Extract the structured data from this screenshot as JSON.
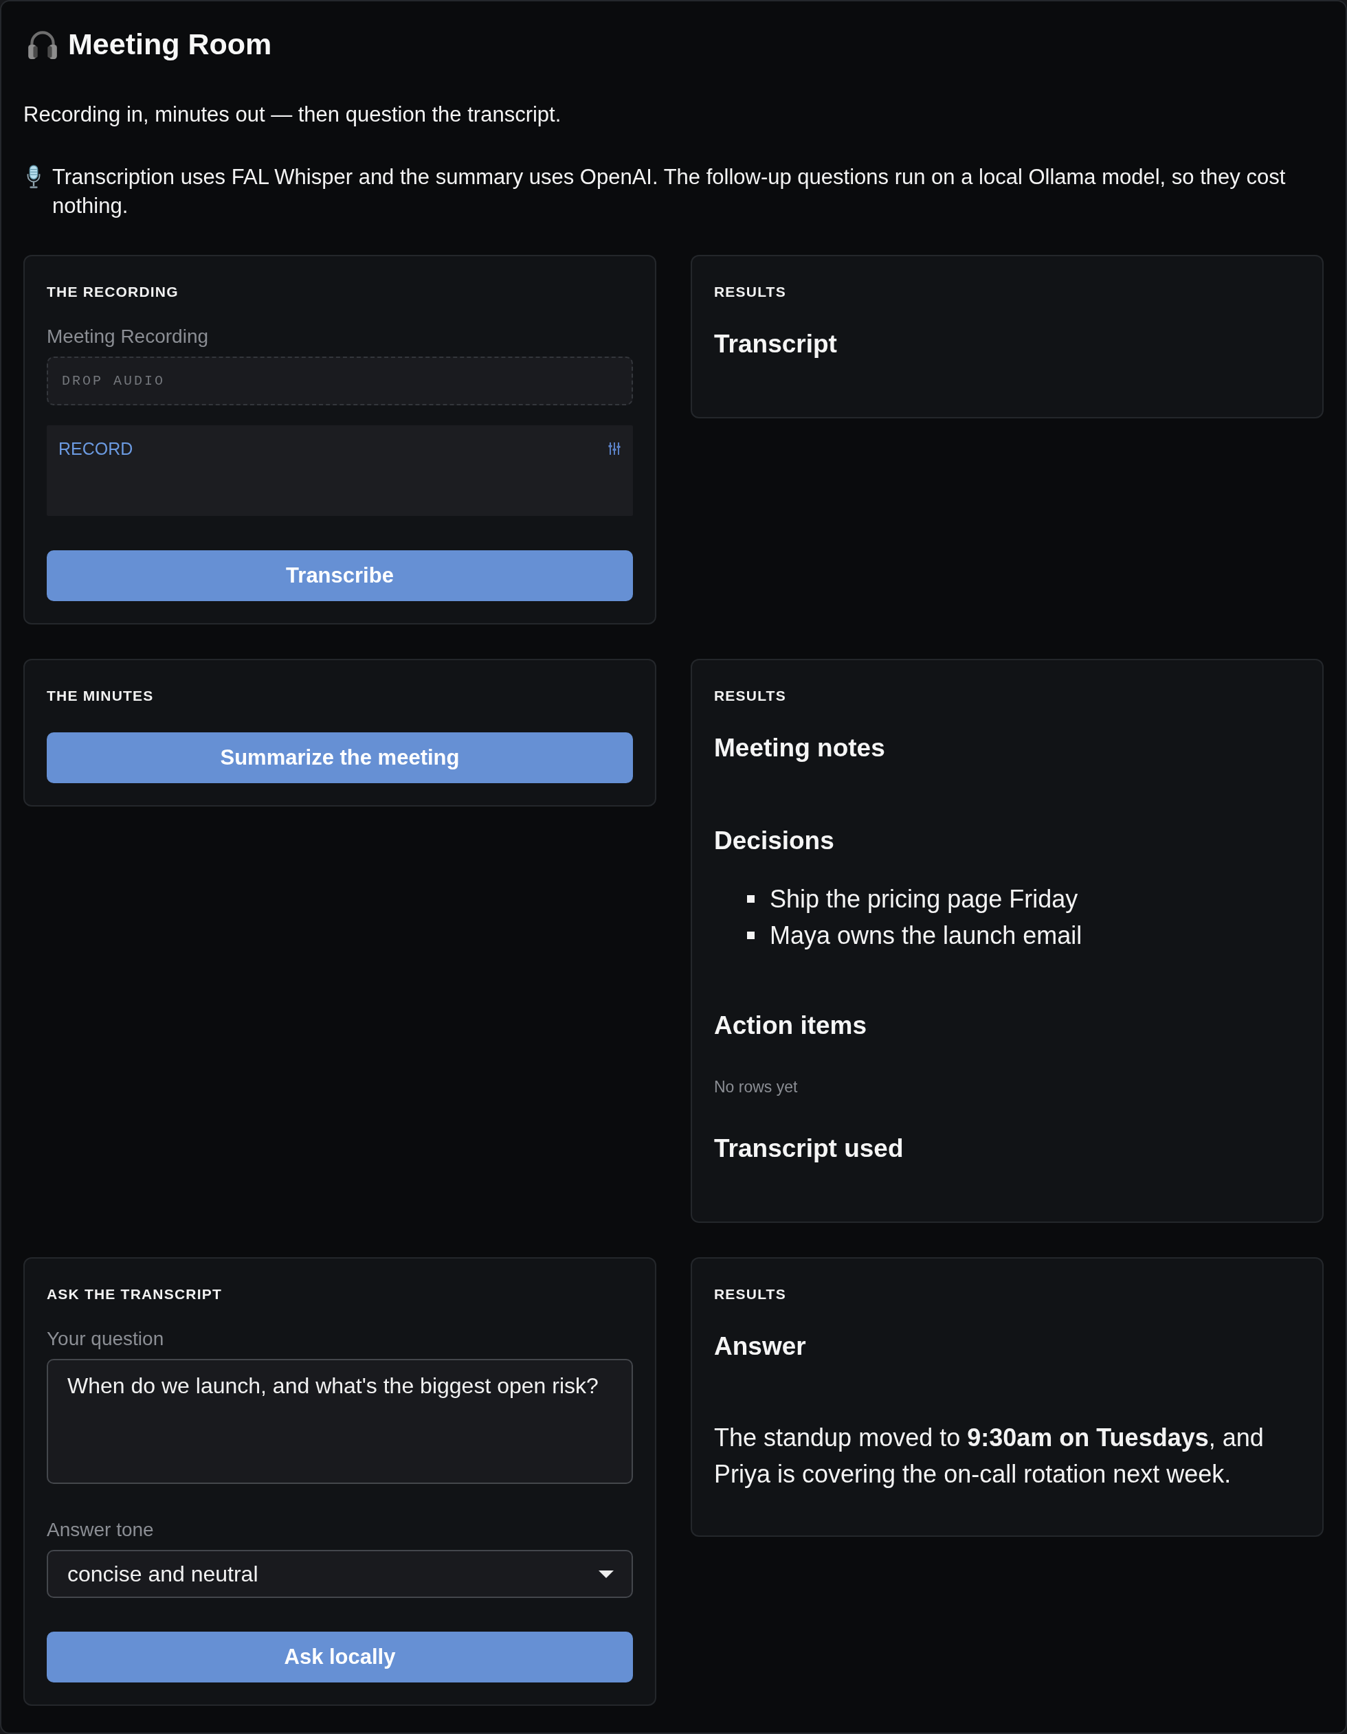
{
  "header": {
    "title": "Meeting Room",
    "tagline": "Recording in, minutes out — then question the transcript.",
    "note": "Transcription uses FAL Whisper and the summary uses OpenAI. The follow-up questions run on a local Ollama model, so they cost nothing."
  },
  "rows": [
    {
      "panel": {
        "heading": "THE RECORDING",
        "controls": [
          {
            "kind": "label",
            "text": "Meeting Recording"
          },
          {
            "kind": "dropzone",
            "text": "DROP AUDIO"
          },
          {
            "kind": "recorder",
            "text": "RECORD"
          },
          {
            "kind": "button",
            "text": "Transcribe"
          }
        ]
      },
      "results": {
        "heading": "RESULTS",
        "blocks": [
          {
            "kind": "title",
            "text": "Transcript"
          }
        ]
      }
    },
    {
      "panel": {
        "heading": "THE MINUTES",
        "controls": [
          {
            "kind": "button",
            "text": "Summarize the meeting"
          }
        ]
      },
      "results": {
        "heading": "RESULTS",
        "blocks": [
          {
            "kind": "title",
            "text": "Meeting notes"
          },
          {
            "kind": "title",
            "text": "Decisions"
          },
          {
            "kind": "bullets",
            "items": [
              "Ship the pricing page Friday",
              "Maya owns the launch email"
            ]
          },
          {
            "kind": "title",
            "text": "Action items"
          },
          {
            "kind": "empty",
            "text": "No rows yet"
          },
          {
            "kind": "title",
            "text": "Transcript used"
          }
        ]
      }
    },
    {
      "panel": {
        "heading": "ASK THE TRANSCRIPT",
        "controls": [
          {
            "kind": "label",
            "text": "Your question"
          },
          {
            "kind": "textarea",
            "value": "When do we launch, and what's the biggest open risk?"
          },
          {
            "kind": "label",
            "text": "Answer tone"
          },
          {
            "kind": "select",
            "value": "concise and neutral"
          },
          {
            "kind": "button",
            "text": "Ask locally"
          }
        ]
      },
      "results": {
        "heading": "RESULTS",
        "blocks": [
          {
            "kind": "title",
            "text": "Answer"
          },
          {
            "kind": "paragraph",
            "text": "The standup moved to **9:30am on Tuesdays**, and Priya is covering the on-call rotation next week."
          }
        ]
      }
    }
  ]
}
